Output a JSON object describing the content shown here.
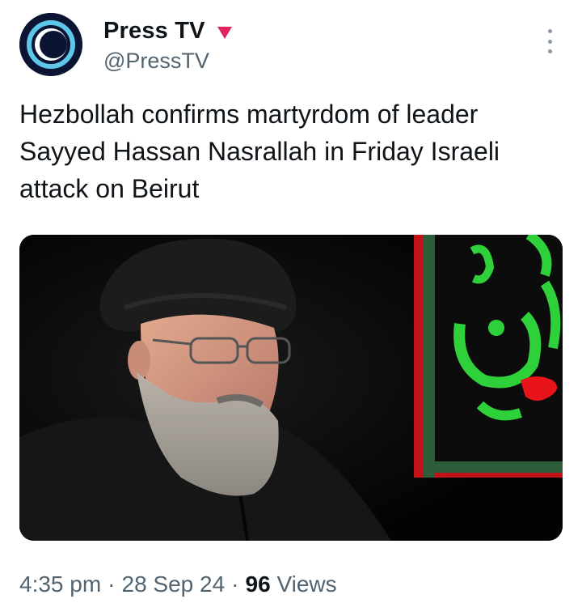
{
  "author": {
    "display_name": "Press TV",
    "handle": "@PressTV",
    "avatar_icon": "presstv-logo-icon",
    "badge_icon": "red-triangle-icon",
    "badge_color": "#e0245e"
  },
  "menu": {
    "icon": "more-options-icon"
  },
  "tweet": {
    "text": "Hezbollah confirms martyrdom of leader\nSayyed Hassan Nasrallah in Friday Israeli\nattack on Beirut"
  },
  "media": {
    "description_icon": "photo-icon"
  },
  "meta": {
    "time": "4:35 pm",
    "separator": "·",
    "date": "28 Sep 24",
    "views_count": "96",
    "views_label": "Views"
  },
  "colors": {
    "text_primary": "#0f1419",
    "text_secondary": "#536471",
    "background": "#ffffff",
    "banner_green": "#2fd13a",
    "banner_red": "#e8141a"
  }
}
